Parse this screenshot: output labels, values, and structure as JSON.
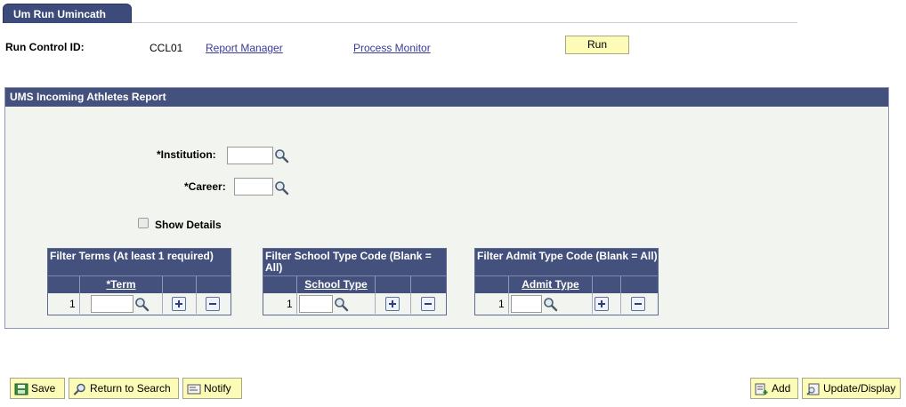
{
  "tab": {
    "label": "Um Run Umincath"
  },
  "run_control": {
    "label": "Run Control ID:",
    "value": "CCL01",
    "report_manager": "Report Manager",
    "process_monitor": "Process Monitor",
    "run_label": "Run"
  },
  "report": {
    "title": "UMS Incoming Athletes Report",
    "institution_label": "*Institution:",
    "institution_value": "",
    "career_label": "*Career:",
    "career_value": "",
    "show_details_label": "Show Details",
    "show_details_checked": false
  },
  "grids": [
    {
      "title": "Filter Terms (At least 1 required)",
      "column": "*Term",
      "rows": [
        {
          "num": "1",
          "value": ""
        }
      ]
    },
    {
      "title": "Filter School Type Code (Blank = All)",
      "column": "School Type",
      "rows": [
        {
          "num": "1",
          "value": ""
        }
      ]
    },
    {
      "title": "Filter Admit Type Code (Blank = All)",
      "column": "Admit Type",
      "rows": [
        {
          "num": "1",
          "value": ""
        }
      ]
    }
  ],
  "footer": {
    "save": "Save",
    "return_to_search": "Return to Search",
    "notify": "Notify",
    "add": "Add",
    "update_display": "Update/Display"
  },
  "colors": {
    "header_blue": "#44517d",
    "button_yellow": "#fcfbb8",
    "panel_bg": "#f2f5ef",
    "link": "#3a3a9a"
  }
}
